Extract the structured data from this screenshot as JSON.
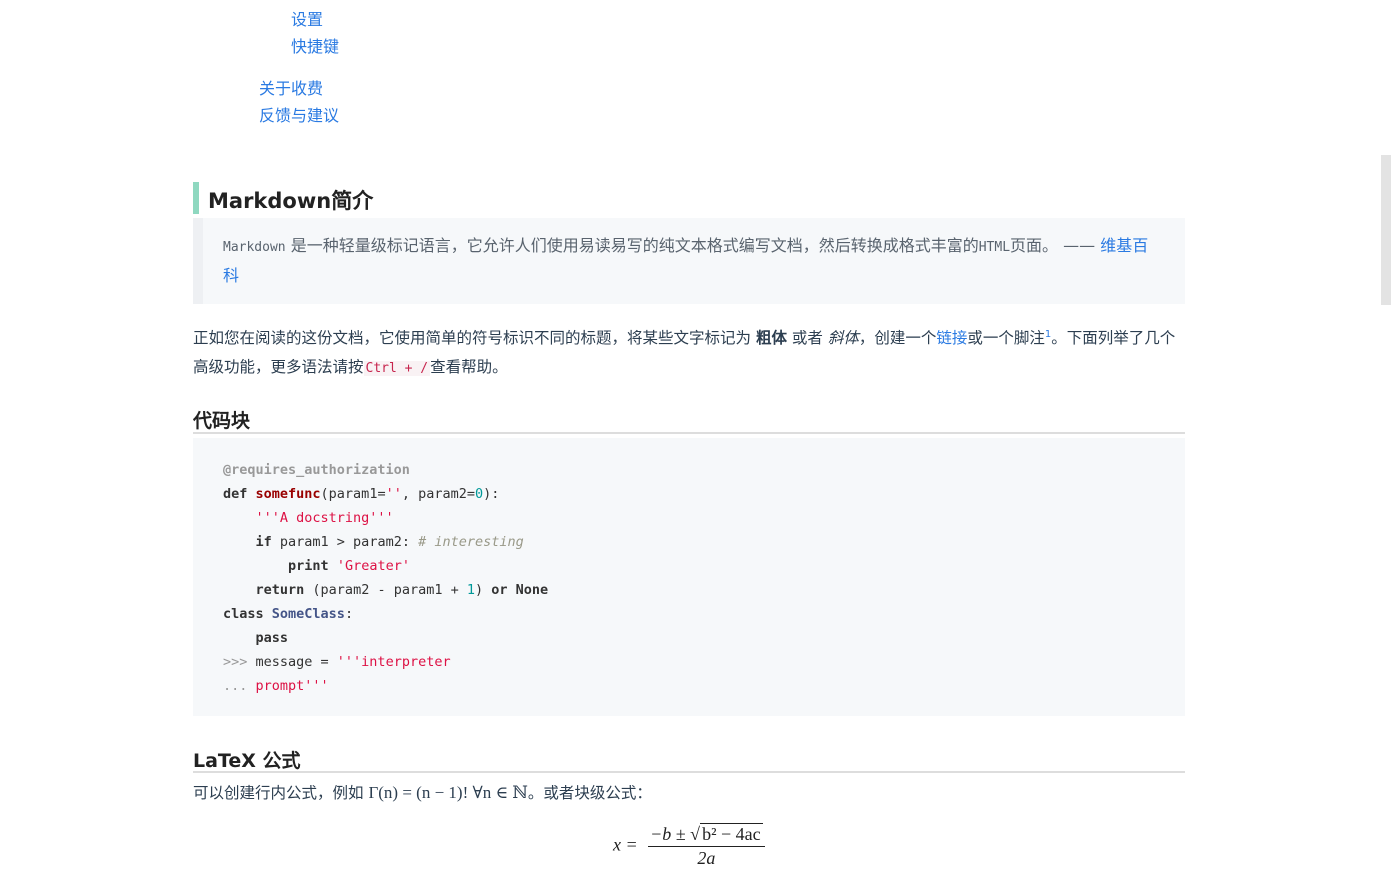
{
  "toc": {
    "items": [
      {
        "label": "设置"
      },
      {
        "label": "快捷键"
      },
      {
        "label": "关于收费"
      },
      {
        "label": "反馈与建议"
      }
    ]
  },
  "section_intro": {
    "title": "Markdown简介",
    "quote": {
      "word_markdown": "Markdown",
      "text": " 是一种轻量级标记语言，它允许人们使用易读易写的纯文本格式编写文档，然后转换成格式丰富的",
      "word_html": "HTML",
      "text_end": "页面。 —— ",
      "link": "维基百科"
    },
    "para": {
      "p1": "正如您在阅读的这份文档，它使用简单的符号标识不同的标题，将某些文字标记为 ",
      "bold": "粗体",
      "p2": " 或者 ",
      "italic": "斜体",
      "p3": "，创建一个",
      "link": "链接",
      "p4": "或一个脚注",
      "footnote": "1",
      "p5": "。下面列举了几个高级功能，更多语法请按",
      "shortcut": "Ctrl + /",
      "p6": "查看帮助。"
    }
  },
  "section_code": {
    "title": "代码块",
    "lines": {
      "l1": "@requires_authorization",
      "l2_def": "def ",
      "l2_fn": "somefunc",
      "l2_a": "(param1=",
      "l2_str": "''",
      "l2_b": ", param2=",
      "l2_num": "0",
      "l2_c": "):",
      "l3": "'''A docstring'''",
      "l4_if": "if",
      "l4_a": " param1 > param2: ",
      "l4_cmt": "# interesting",
      "l5_print": "print",
      "l5_str": "'Greater'",
      "l6_ret": "return",
      "l6_a": " (param2 - param1 + ",
      "l6_num": "1",
      "l6_b": ") ",
      "l6_or": "or",
      "l6_none": " None",
      "l7_class": "class ",
      "l7_name": "SomeClass",
      "l7_colon": ":",
      "l8": "pass",
      "l9_prompt": ">>>",
      "l9_a": " message = ",
      "l9_str": "'''interpreter",
      "l10_prompt": "...",
      "l10_str": " prompt'''"
    }
  },
  "section_latex": {
    "title": "LaTeX 公式",
    "text_a": "可以创建行内公式，例如 ",
    "inline_formula": "Γ(n) = (n − 1)!   ∀n ∈ ℕ",
    "text_b": "。或者块级公式：",
    "block_lhs": "x = ",
    "block_num_a": "−b ± ",
    "block_sqrt_sym": "√",
    "block_sqrt": "b² − 4ac",
    "block_den": "2a"
  }
}
